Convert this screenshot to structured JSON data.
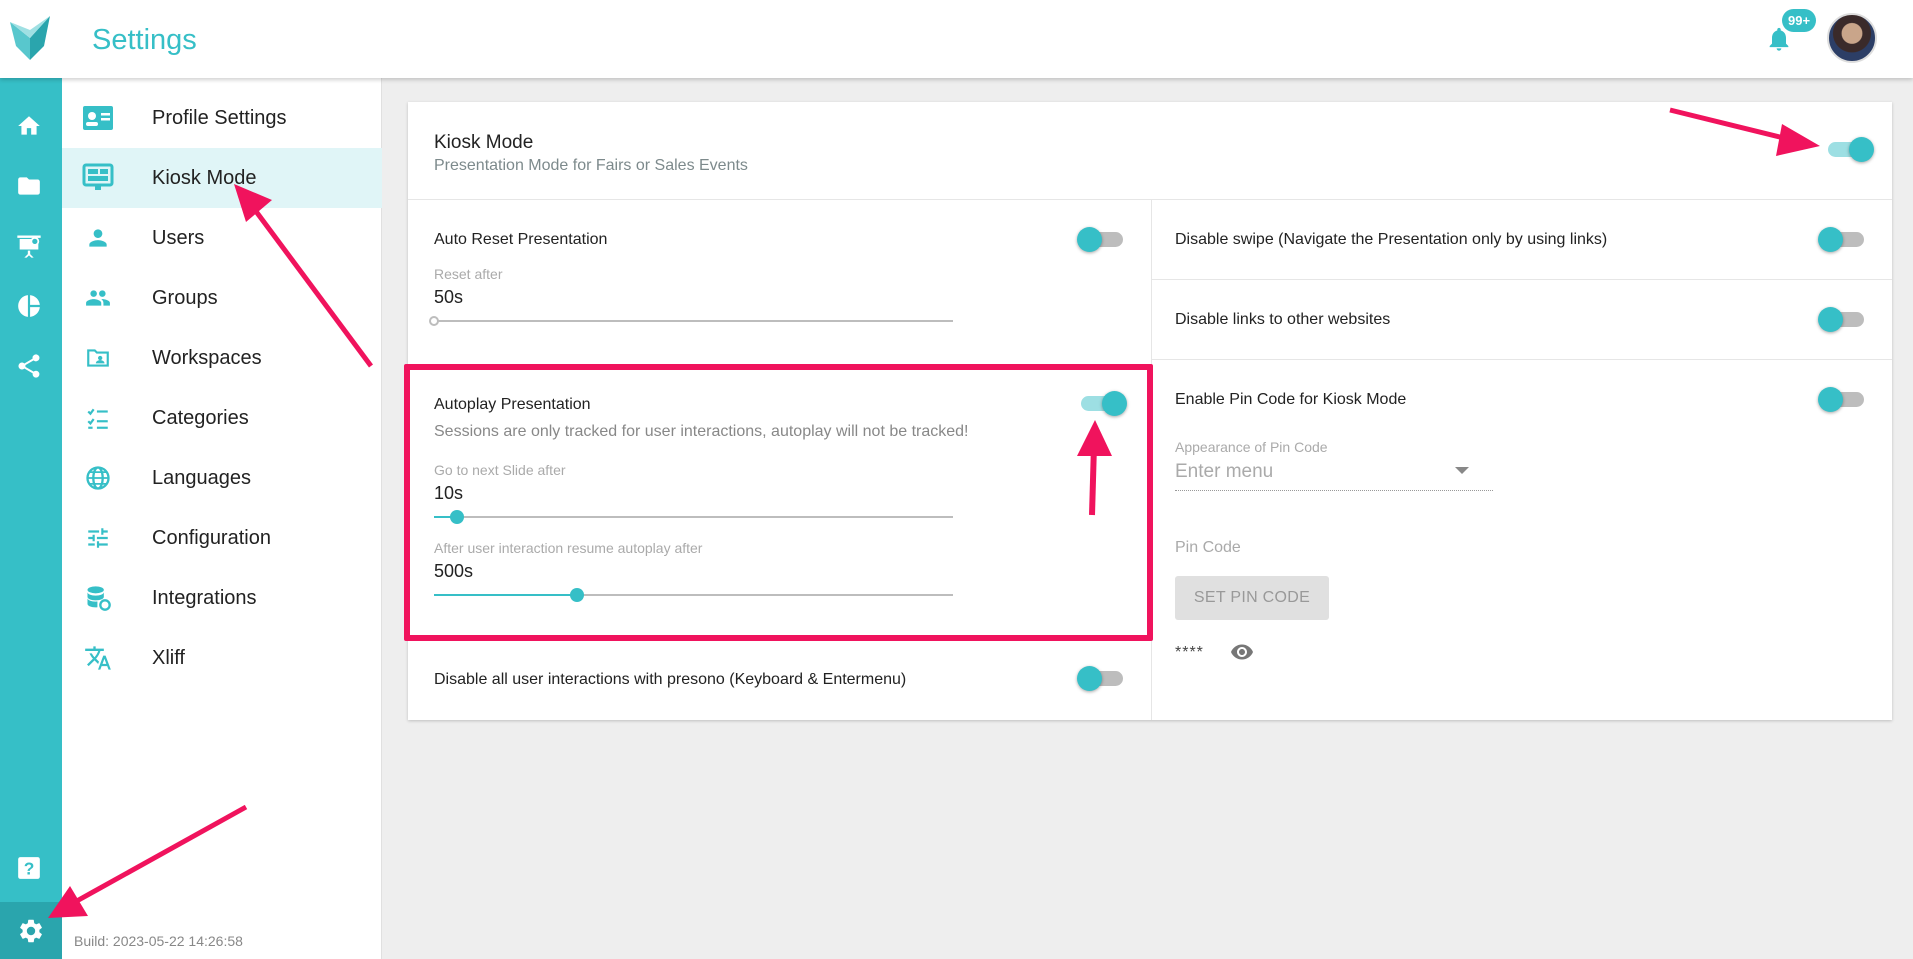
{
  "header": {
    "title": "Settings",
    "notification_badge": "99+",
    "accent_color": "#36bfc7"
  },
  "rail": {
    "icons": [
      "home-icon",
      "folder-icon",
      "presentation-icon",
      "pie-chart-icon",
      "share-icon",
      "help-icon",
      "gear-icon"
    ]
  },
  "subnav": {
    "items": [
      {
        "label": "Profile Settings",
        "icon": "profile-card-icon"
      },
      {
        "label": "Kiosk Mode",
        "icon": "kiosk-monitor-icon",
        "active": true
      },
      {
        "label": "Users",
        "icon": "user-icon"
      },
      {
        "label": "Groups",
        "icon": "groups-icon"
      },
      {
        "label": "Workspaces",
        "icon": "workspace-folder-icon"
      },
      {
        "label": "Categories",
        "icon": "checklist-icon"
      },
      {
        "label": "Languages",
        "icon": "globe-icon"
      },
      {
        "label": "Configuration",
        "icon": "sliders-icon"
      },
      {
        "label": "Integrations",
        "icon": "database-sync-icon"
      },
      {
        "label": "Xliff",
        "icon": "translate-icon"
      }
    ],
    "build": "Build: 2023-05-22 14:26:58"
  },
  "kiosk": {
    "title": "Kiosk Mode",
    "subtitle": "Presentation Mode for Fairs or Sales Events",
    "enabled": true,
    "auto_reset": {
      "label": "Auto Reset Presentation",
      "enabled": false,
      "reset_after_label": "Reset after",
      "reset_after_value": "50s",
      "slider_fraction": 0
    },
    "autoplay": {
      "label": "Autoplay Presentation",
      "enabled": true,
      "note": "Sessions are only tracked for user interactions, autoplay will not be tracked!",
      "next_slide_label": "Go to next Slide after",
      "next_slide_value": "10s",
      "next_slide_fraction": 0.045,
      "resume_label": "After user interaction resume autoplay after",
      "resume_value": "500s",
      "resume_fraction": 0.275
    },
    "disable_interactions": {
      "label": "Disable all user interactions with presono (Keyboard & Entermenu)",
      "enabled": false
    },
    "disable_swipe": {
      "label": "Disable swipe (Navigate the Presentation only by using links)",
      "enabled": false
    },
    "disable_links": {
      "label": "Disable links to other websites",
      "enabled": false
    },
    "pin": {
      "label": "Enable Pin Code for Kiosk Mode",
      "enabled": false,
      "appearance_label": "Appearance of Pin Code",
      "appearance_placeholder": "Enter menu",
      "pin_code_label": "Pin Code",
      "set_button": "SET PIN CODE",
      "masked_value": "****"
    }
  },
  "annotation_color": "#f0135d"
}
